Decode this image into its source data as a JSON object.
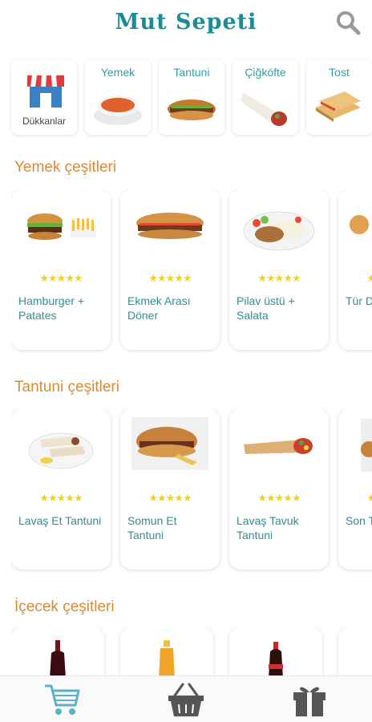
{
  "app": {
    "title": "Mut Sepeti"
  },
  "header": {
    "search_icon": "search-icon"
  },
  "categories": [
    {
      "label": "Dükkanlar",
      "icon": "store-icon"
    },
    {
      "label": "Yemek",
      "icon": "soup-image"
    },
    {
      "label": "Tantuni",
      "icon": "sandwich-image"
    },
    {
      "label": "Çiğköfte",
      "icon": "wrap-image"
    },
    {
      "label": "Tost",
      "icon": "toast-image"
    }
  ],
  "sections": {
    "yemek": {
      "title": "Yemek çeşitleri"
    },
    "tantuni": {
      "title": "Tantuni çeşitleri"
    },
    "icecek": {
      "title": "İçecek çeşitleri"
    }
  },
  "yemek_items": [
    {
      "name": "Hamburger + Patates",
      "stars": "★★★★★"
    },
    {
      "name": "Ekmek Arası Döner",
      "stars": "★★★★★"
    },
    {
      "name": "Pilav üstü + Salata",
      "stars": "★★★★★"
    },
    {
      "name": "Tür Dür",
      "stars": "★★★★★"
    }
  ],
  "tantuni_items": [
    {
      "name": "Lavaş Et Tantuni",
      "stars": "★★★★★"
    },
    {
      "name": "Somun Et Tantuni",
      "stars": "★★★★★"
    },
    {
      "name": "Lavaş Tavuk Tantuni",
      "stars": "★★★★★"
    },
    {
      "name": "Son Tar",
      "stars": "★★★★★"
    }
  ],
  "bottom_nav": [
    {
      "icon": "cart-icon",
      "color": "#5ab3c4"
    },
    {
      "icon": "basket-icon",
      "color": "#555555"
    },
    {
      "icon": "gift-icon",
      "color": "#555555"
    }
  ]
}
